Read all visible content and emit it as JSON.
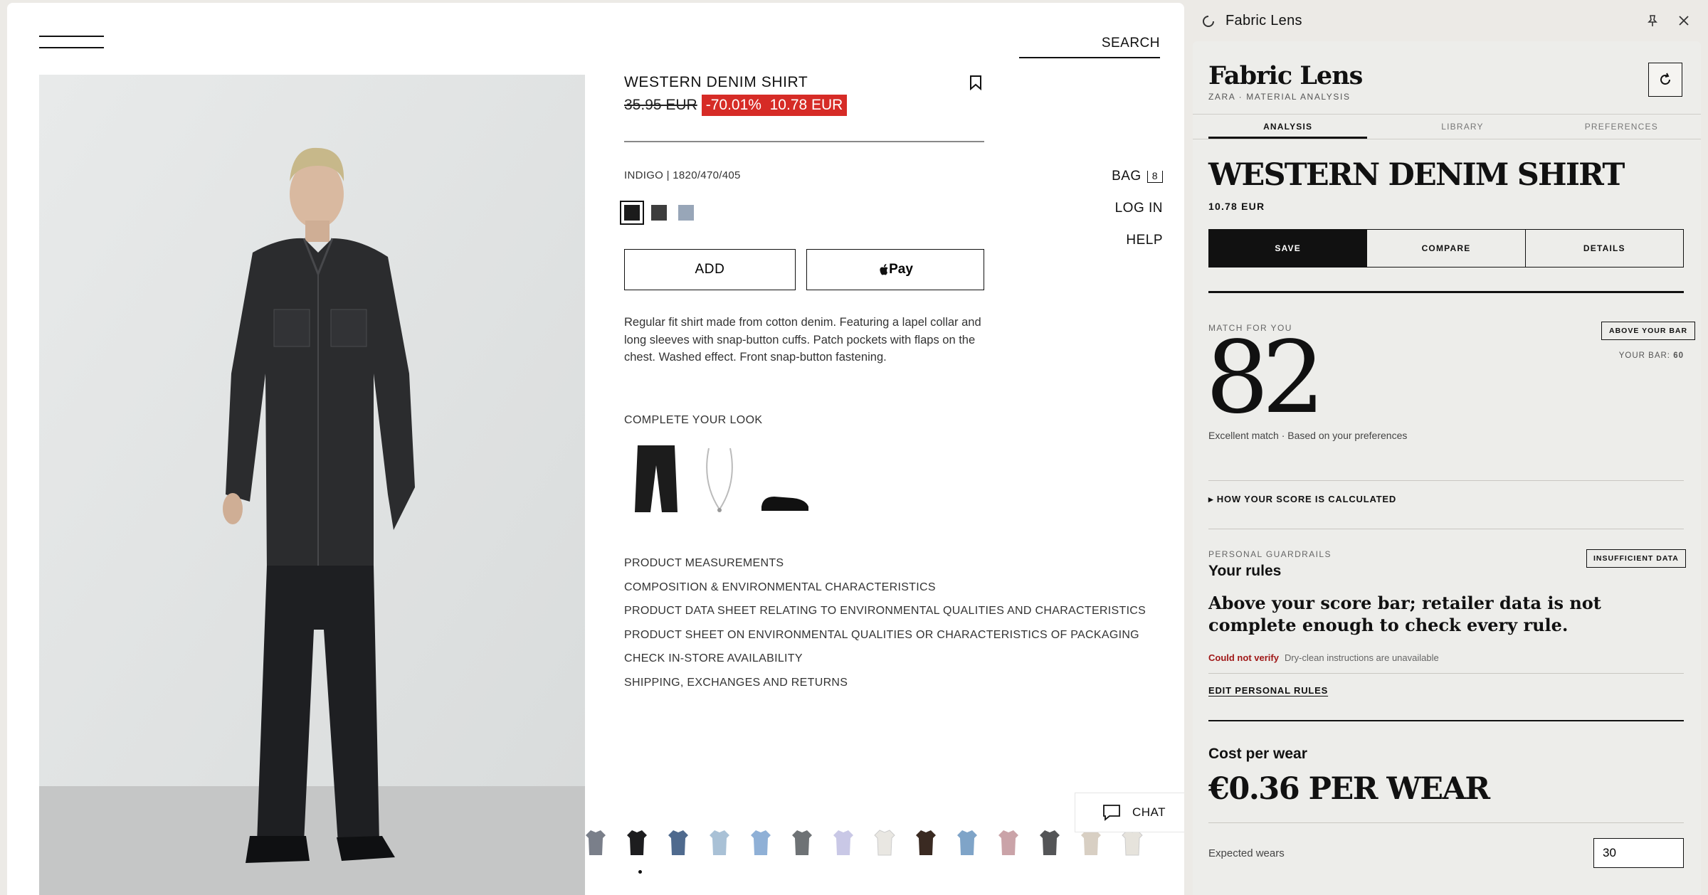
{
  "shop": {
    "search_label": "SEARCH",
    "product_name": "WESTERN DENIM SHIRT",
    "old_price": "35.95 EUR",
    "discount": "-70.01%",
    "new_price": "10.78 EUR",
    "sku": "INDIGO | 1820/470/405",
    "swatches": [
      "#1b1b1b",
      "#3d3d3d",
      "#98a6b8"
    ],
    "add_label": "ADD",
    "pay_label": "Pay",
    "description": "Regular fit shirt made from cotton denim. Featuring a lapel collar and long sleeves with snap-button cuffs. Patch pockets with flaps on the chest. Washed effect. Front snap-button fastening.",
    "complete_look": "COMPLETE YOUR LOOK",
    "nav": {
      "bag": "BAG",
      "bag_count": "8",
      "login": "LOG IN",
      "help": "HELP"
    },
    "links": [
      "PRODUCT MEASUREMENTS",
      "COMPOSITION & ENVIRONMENTAL CHARACTERISTICS",
      "PRODUCT DATA SHEET RELATING TO ENVIRONMENTAL QUALITIES AND CHARACTERISTICS",
      "PRODUCT SHEET ON ENVIRONMENTAL QUALITIES OR CHARACTERISTICS OF PACKAGING",
      "CHECK IN-STORE AVAILABILITY",
      "SHIPPING, EXCHANGES AND RETURNS"
    ],
    "chat_label": "CHAT",
    "thumb_colors": [
      "#7a7f8a",
      "#1d1d1f",
      "#4f6a8e",
      "#a9c1d6",
      "#8fb0d6",
      "#6e7275",
      "#c9c8e6",
      "#e9e7e2",
      "#3a2a22",
      "#7fa4c8",
      "#caa3a8",
      "#545557",
      "#d8cfc3",
      "#e6e3dc"
    ]
  },
  "panel": {
    "window_title": "Fabric Lens",
    "brand": "Fabric Lens",
    "brand_sub": "ZARA · MATERIAL ANALYSIS",
    "tabs": [
      "ANALYSIS",
      "LIBRARY",
      "PREFERENCES"
    ],
    "product": "WESTERN DENIM SHIRT",
    "price": "10.78 EUR",
    "actions": [
      "SAVE",
      "COMPARE",
      "DETAILS"
    ],
    "match_label": "MATCH FOR YOU",
    "match_badge": "ABOVE YOUR BAR",
    "your_bar_label": "YOUR BAR:",
    "your_bar_value": "60",
    "score": "82",
    "score_note": "Excellent match · Based on your preferences",
    "how_label": "HOW YOUR SCORE IS CALCULATED",
    "guardrails_label": "PERSONAL GUARDRAILS",
    "rules_title": "Your rules",
    "rules_badge": "INSUFFICIENT DATA",
    "rules_text": "Above your score bar; retailer data is not complete enough to check every rule.",
    "could_not_verify": "Could not verify",
    "unverified_item": "Dry-clean instructions are unavailable",
    "edit_rules": "EDIT PERSONAL RULES",
    "cpw_label": "Cost per wear",
    "cpw_value": "€0.36 PER WEAR",
    "expected_wears_label": "Expected wears",
    "expected_wears_value": "30"
  }
}
